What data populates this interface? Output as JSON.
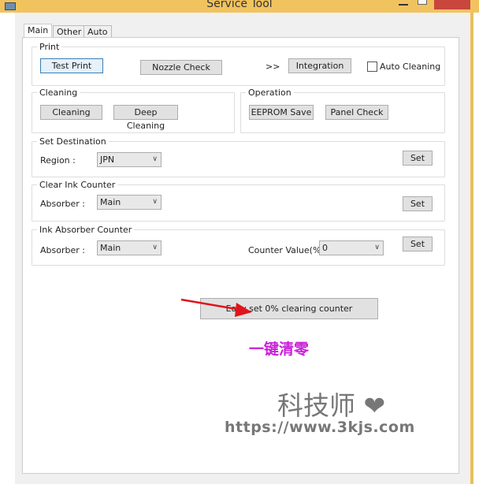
{
  "window": {
    "title": "Service Tool"
  },
  "tabs": [
    {
      "label": "Main",
      "active": true
    },
    {
      "label": "Other"
    },
    {
      "label": "Auto"
    }
  ],
  "print": {
    "group_label": "Print",
    "test_print": "Test Print",
    "nozzle_check": "Nozzle Check",
    "chevron": ">>",
    "integration": "Integration",
    "auto_cleaning": "Auto Cleaning",
    "auto_cleaning_checked": false
  },
  "cleaning": {
    "group_label": "Cleaning",
    "cleaning": "Cleaning",
    "deep_cleaning": "Deep Cleaning"
  },
  "operation": {
    "group_label": "Operation",
    "eeprom_save": "EEPROM Save",
    "panel_check": "Panel Check"
  },
  "destination": {
    "group_label": "Set Destination",
    "region_label": "Region :",
    "region_value": "JPN",
    "set": "Set"
  },
  "clear_ink": {
    "group_label": "Clear Ink Counter",
    "absorber_label": "Absorber :",
    "absorber_value": "Main",
    "set": "Set"
  },
  "ink_absorber": {
    "group_label": "Ink Absorber Counter",
    "absorber_label": "Absorber :",
    "absorber_value": "Main",
    "counter_label": "Counter Value(%)",
    "counter_value": "0",
    "set": "Set"
  },
  "easy_set": "Easy set 0% clearing counter",
  "annotation": {
    "text": "一键清零",
    "arrow_color": "#e0141a",
    "text_color": "#c81fd8"
  },
  "watermark": {
    "name": "科技师",
    "url": "https://www.3kjs.com"
  }
}
